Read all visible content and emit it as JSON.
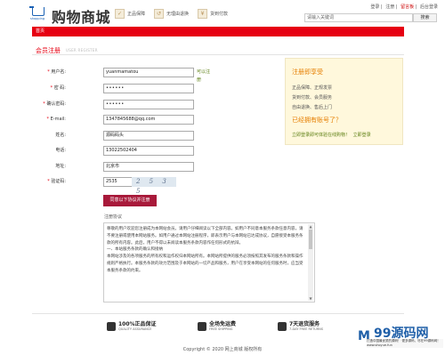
{
  "header": {
    "logo_sub": "shopping",
    "brand": "购物商城",
    "features": [
      {
        "icon": "guarantee-icon",
        "label": "正品保障"
      },
      {
        "icon": "return-icon",
        "label": "无理由退换"
      },
      {
        "icon": "cod-icon",
        "label": "货到付款"
      }
    ],
    "links": [
      "登录",
      "注册",
      "留言板",
      "后台登录"
    ],
    "search_placeholder": "请输入关键词",
    "search_button": "搜索"
  },
  "nav": {
    "home": "首页"
  },
  "page": {
    "title": "会员注册",
    "title_en": "USER REGISTER"
  },
  "form": {
    "username": {
      "label": "用户名:",
      "value": "yuanmamatou",
      "hint": "可以注册"
    },
    "password": {
      "label": "密  码:",
      "value": "••••••"
    },
    "confirm": {
      "label": "确认密码:",
      "value": "••••••"
    },
    "email": {
      "label": "E-mail:",
      "value": "1347845688@qq.com"
    },
    "name": {
      "label": "姓名:",
      "value": "源码码头"
    },
    "phone": {
      "label": "电话:",
      "value": "13022502404"
    },
    "address": {
      "label": "地址:",
      "value": "北京市"
    },
    "captcha": {
      "label": "验证码:",
      "value": "2535",
      "image_text": "2 5 3 5"
    },
    "submit": "同意以下协议并注册",
    "agreement_title": "注册协议",
    "agreement_text": [
      "尊敬的用户欢迎您注册成为本网站会员。请用户仔细阅读以下全部内容。如用户不同意本服务条款任意内容，请不要注册或使用本网站服务。如用户通过本网站注册程序，即表示用户与本网站已达成协议，自愿接受本服务条款的所有内容。此后，用户不得以未阅读本服务条款内容作任何形式的抗辩。",
      "一、本站服务条款的确认和接纳",
      "本网站涉及的各项服务的所有权和运作权归本网站所有。本网站所提供的服务必须按照其发布的服务条款和操作规则严格执行。本服务条款的效力范围及于本网站的一切产品和服务，用户在享受本网站的任何服务时，应当受本服务条款的约束。"
    ]
  },
  "sidebar": {
    "title": "注册即享受",
    "items": [
      "正品保障、正规发票",
      "货到付款、会员服务",
      "自由退换、售后上门"
    ],
    "question": "已经拥有账号了？",
    "login_text": "立即登录即可体验在线购物！",
    "login_link": "立即登录"
  },
  "footer": {
    "badges": [
      {
        "title": "100%正品保证",
        "sub": "QUALITY ASSURANCE"
      },
      {
        "title": "全场免运费",
        "sub": "FREE SHIPPING"
      },
      {
        "title": "7天退货服务",
        "sub": "7-DAY FREE RETURNS"
      }
    ],
    "copyright": "Copyright © 2020 网上商城 版权所有"
  },
  "watermark": {
    "text": "99源码网",
    "sub": "打造中国最优质的源码！·更多源码，尽在99源码网！www.shoyue.fun"
  }
}
